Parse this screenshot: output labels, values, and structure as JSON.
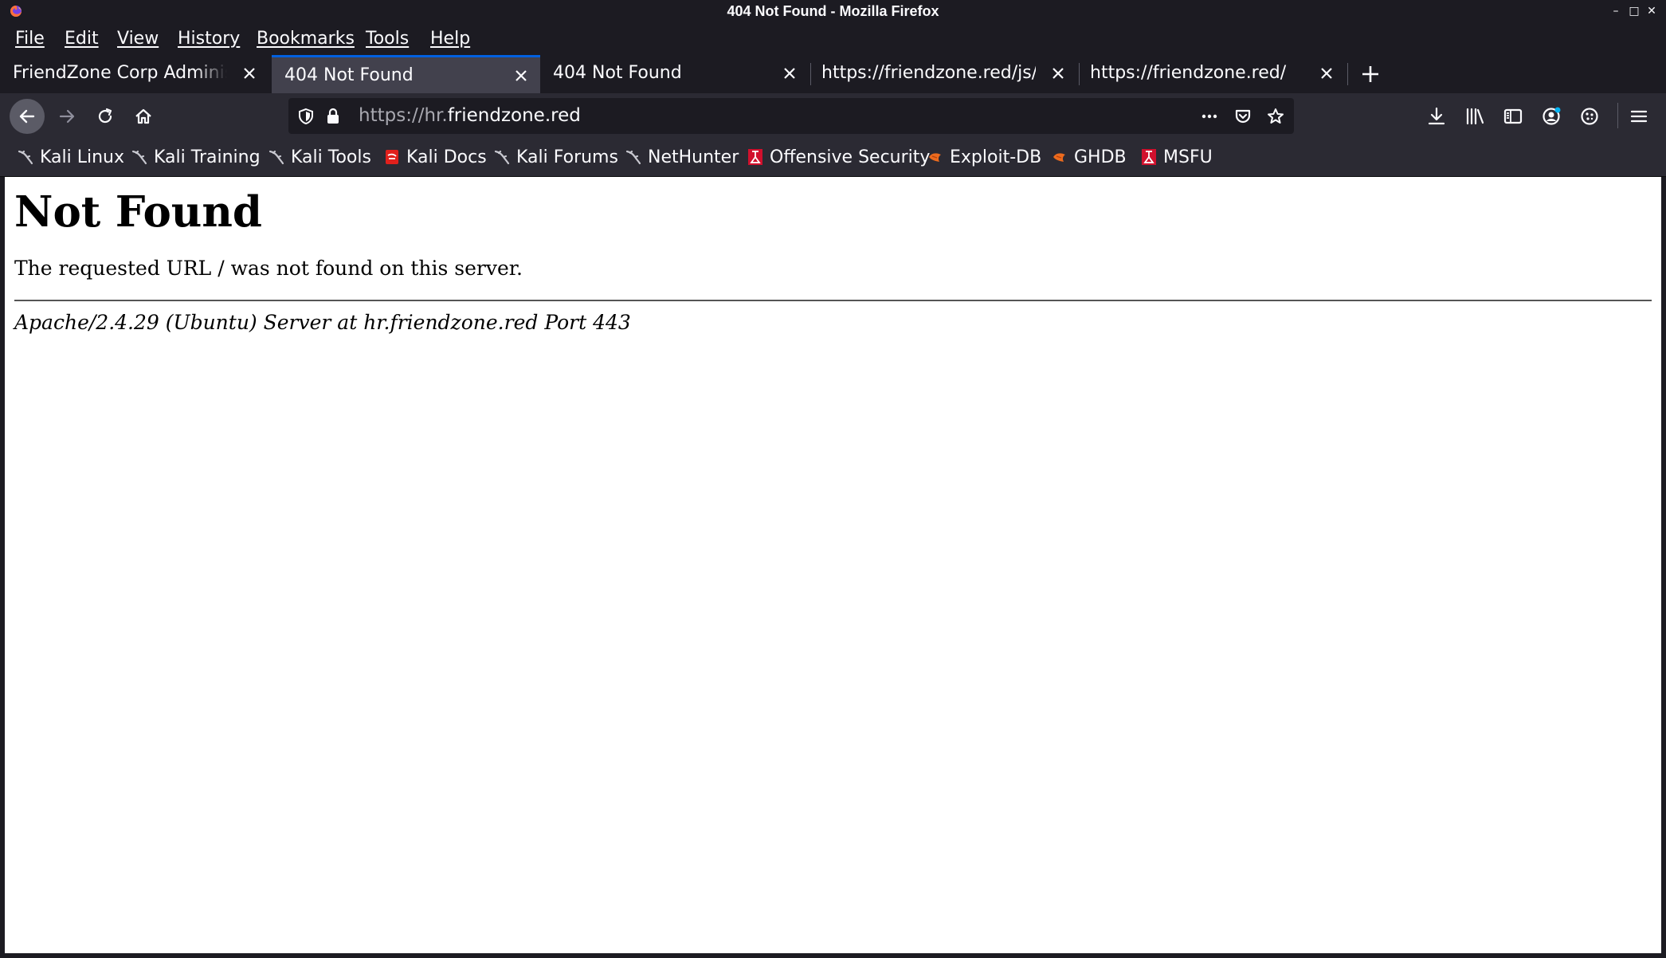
{
  "window": {
    "title": "404 Not Found - Mozilla Firefox",
    "controls": {
      "minimize": "–",
      "maximize": "□",
      "close": "✕"
    }
  },
  "menubar": {
    "items": [
      {
        "label": "File"
      },
      {
        "label": "Edit"
      },
      {
        "label": "View"
      },
      {
        "label": "History"
      },
      {
        "label": "Bookmarks"
      },
      {
        "label": "Tools"
      },
      {
        "label": "Help"
      }
    ]
  },
  "tabs": [
    {
      "label": "FriendZone Corp Administrator Page",
      "selected": false
    },
    {
      "label": "404 Not Found",
      "selected": true
    },
    {
      "label": "404 Not Found",
      "selected": false
    },
    {
      "label": "https://friendzone.red/js/js/",
      "selected": false
    },
    {
      "label": "https://friendzone.red/",
      "selected": false
    }
  ],
  "urlbar": {
    "scheme_host_prefix": "https://hr.",
    "domain": "friendzone.red"
  },
  "bookmarks": [
    {
      "label": "Kali Linux",
      "icon": "kali-dragon-icon"
    },
    {
      "label": "Kali Training",
      "icon": "kali-dragon-icon"
    },
    {
      "label": "Kali Tools",
      "icon": "kali-dragon-icon"
    },
    {
      "label": "Kali Docs",
      "icon": "kali-docs-icon"
    },
    {
      "label": "Kali Forums",
      "icon": "kali-dragon-icon"
    },
    {
      "label": "NetHunter",
      "icon": "kali-dragon-icon"
    },
    {
      "label": "Offensive Security",
      "icon": "offsec-icon"
    },
    {
      "label": "Exploit-DB",
      "icon": "exploitdb-icon"
    },
    {
      "label": "GHDB",
      "icon": "exploitdb-icon"
    },
    {
      "label": "MSFU",
      "icon": "offsec-icon"
    }
  ],
  "page": {
    "heading": "Not Found",
    "message": "The requested URL / was not found on this server.",
    "address": "Apache/2.4.29 (Ubuntu) Server at hr.friendzone.red Port 443"
  },
  "colors": {
    "chrome_dark": "#1c1b22",
    "toolbar": "#2b2a33",
    "selected_tab": "#42414d",
    "accent": "#0060df",
    "notification_dot": "#00b3f4"
  }
}
